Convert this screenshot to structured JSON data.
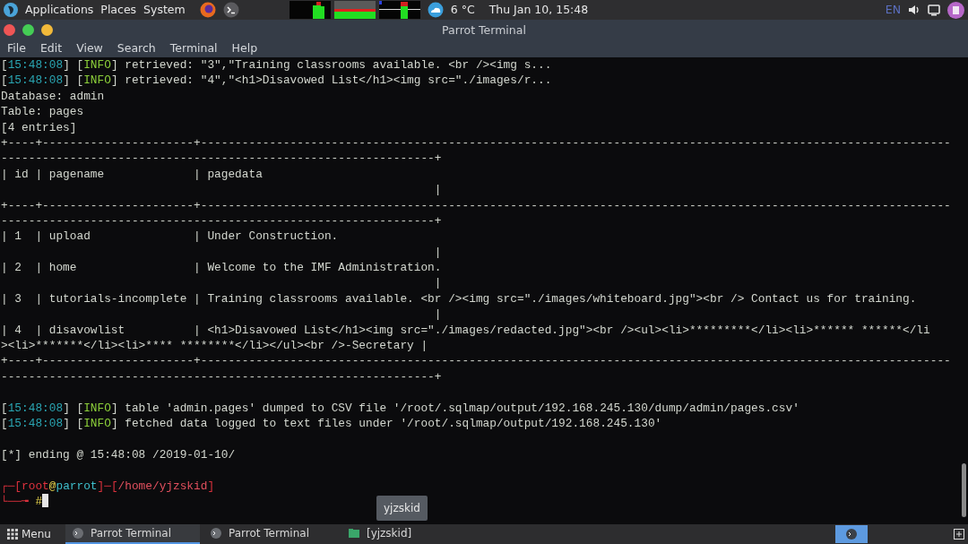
{
  "top_panel": {
    "menus": [
      "Applications",
      "Places",
      "System"
    ],
    "weather": "6 °C",
    "clock": "Thu Jan 10, 15:48",
    "keyboard_layout": "EN"
  },
  "window": {
    "title": "Parrot Terminal",
    "menu": [
      "File",
      "Edit",
      "View",
      "Search",
      "Terminal",
      "Help"
    ]
  },
  "terminal": {
    "lines": [
      {
        "segments": [
          {
            "kind": "plain",
            "text": "["
          },
          {
            "kind": "time",
            "text": "15:48:08"
          },
          {
            "kind": "plain",
            "text": "] ["
          },
          {
            "kind": "level",
            "text": "INFO"
          },
          {
            "kind": "plain",
            "text": "] retrieved: \"3\",\"Training classrooms available. <br /><img s..."
          }
        ]
      },
      {
        "segments": [
          {
            "kind": "plain",
            "text": "["
          },
          {
            "kind": "time",
            "text": "15:48:08"
          },
          {
            "kind": "plain",
            "text": "] ["
          },
          {
            "kind": "level",
            "text": "INFO"
          },
          {
            "kind": "plain",
            "text": "] retrieved: \"4\",\"<h1>Disavowed List</h1><img src=\"./images/r..."
          }
        ]
      },
      {
        "segments": [
          {
            "kind": "plain",
            "text": "Database: admin"
          }
        ]
      },
      {
        "segments": [
          {
            "kind": "plain",
            "text": "Table: pages"
          }
        ]
      },
      {
        "segments": [
          {
            "kind": "plain",
            "text": "[4 entries]"
          }
        ]
      },
      {
        "segments": [
          {
            "kind": "plain",
            "text": "+----+----------------------+-------------------------------------------------------------------------------------------------------------"
          }
        ]
      },
      {
        "segments": [
          {
            "kind": "plain",
            "text": "---------------------------------------------------------------+"
          }
        ]
      },
      {
        "segments": [
          {
            "kind": "plain",
            "text": "| id | pagename             | pagedata"
          }
        ]
      },
      {
        "segments": [
          {
            "kind": "plain",
            "text": "                                                               |"
          }
        ]
      },
      {
        "segments": [
          {
            "kind": "plain",
            "text": "+----+----------------------+-------------------------------------------------------------------------------------------------------------"
          }
        ]
      },
      {
        "segments": [
          {
            "kind": "plain",
            "text": "---------------------------------------------------------------+"
          }
        ]
      },
      {
        "segments": [
          {
            "kind": "plain",
            "text": "| 1  | upload               | Under Construction."
          }
        ]
      },
      {
        "segments": [
          {
            "kind": "plain",
            "text": "                                                               |"
          }
        ]
      },
      {
        "segments": [
          {
            "kind": "plain",
            "text": "| 2  | home                 | Welcome to the IMF Administration."
          }
        ]
      },
      {
        "segments": [
          {
            "kind": "plain",
            "text": "                                                               |"
          }
        ]
      },
      {
        "segments": [
          {
            "kind": "plain",
            "text": "| 3  | tutorials-incomplete | Training classrooms available. <br /><img src=\"./images/whiteboard.jpg\"><br /> Contact us for training."
          }
        ]
      },
      {
        "segments": [
          {
            "kind": "plain",
            "text": "                                                               |"
          }
        ]
      },
      {
        "segments": [
          {
            "kind": "plain",
            "text": "| 4  | disavowlist          | <h1>Disavowed List</h1><img src=\"./images/redacted.jpg\"><br /><ul><li>*********</li><li>****** ******</li"
          }
        ]
      },
      {
        "segments": [
          {
            "kind": "plain",
            "text": "><li>*******</li><li>**** ********</li></ul><br />-Secretary |"
          }
        ]
      },
      {
        "segments": [
          {
            "kind": "plain",
            "text": "+----+----------------------+-------------------------------------------------------------------------------------------------------------"
          }
        ]
      },
      {
        "segments": [
          {
            "kind": "plain",
            "text": "---------------------------------------------------------------+"
          }
        ],
        "blank_after": true
      },
      {
        "segments": [
          {
            "kind": "plain",
            "text": "["
          },
          {
            "kind": "time",
            "text": "15:48:08"
          },
          {
            "kind": "plain",
            "text": "] ["
          },
          {
            "kind": "level",
            "text": "INFO"
          },
          {
            "kind": "plain",
            "text": "] table 'admin.pages' dumped to CSV file '/root/.sqlmap/output/192.168.245.130/dump/admin/pages.csv'"
          }
        ]
      },
      {
        "segments": [
          {
            "kind": "plain",
            "text": "["
          },
          {
            "kind": "time",
            "text": "15:48:08"
          },
          {
            "kind": "plain",
            "text": "] ["
          },
          {
            "kind": "level",
            "text": "INFO"
          },
          {
            "kind": "plain",
            "text": "] fetched data logged to text files under '/root/.sqlmap/output/192.168.245.130'"
          }
        ],
        "blank_after": true
      },
      {
        "segments": [
          {
            "kind": "plain",
            "text": "[*] ending @ 15:48:08 /2019-01-10/"
          }
        ],
        "blank_after": true
      },
      {
        "segments": [
          {
            "kind": "frame",
            "text": "┌─["
          },
          {
            "kind": "user",
            "text": "root"
          },
          {
            "kind": "at",
            "text": "@"
          },
          {
            "kind": "host",
            "text": "parrot"
          },
          {
            "kind": "frame",
            "text": "]─["
          },
          {
            "kind": "path",
            "text": "/home/yjzskid"
          },
          {
            "kind": "frame",
            "text": "]"
          }
        ]
      },
      {
        "segments": [
          {
            "kind": "frame",
            "text": "└──╼ "
          },
          {
            "kind": "symbol",
            "text": "#"
          }
        ],
        "cursor": true
      }
    ]
  },
  "tooltip": "yjzskid",
  "taskbar": {
    "menu": "Menu",
    "tasks": [
      {
        "label": "Parrot Terminal",
        "kind": "terminal",
        "selected": true
      },
      {
        "label": "Parrot Terminal",
        "kind": "terminal",
        "selected": false
      },
      {
        "label": "[yjzskid]",
        "kind": "folder",
        "selected": false
      }
    ]
  }
}
